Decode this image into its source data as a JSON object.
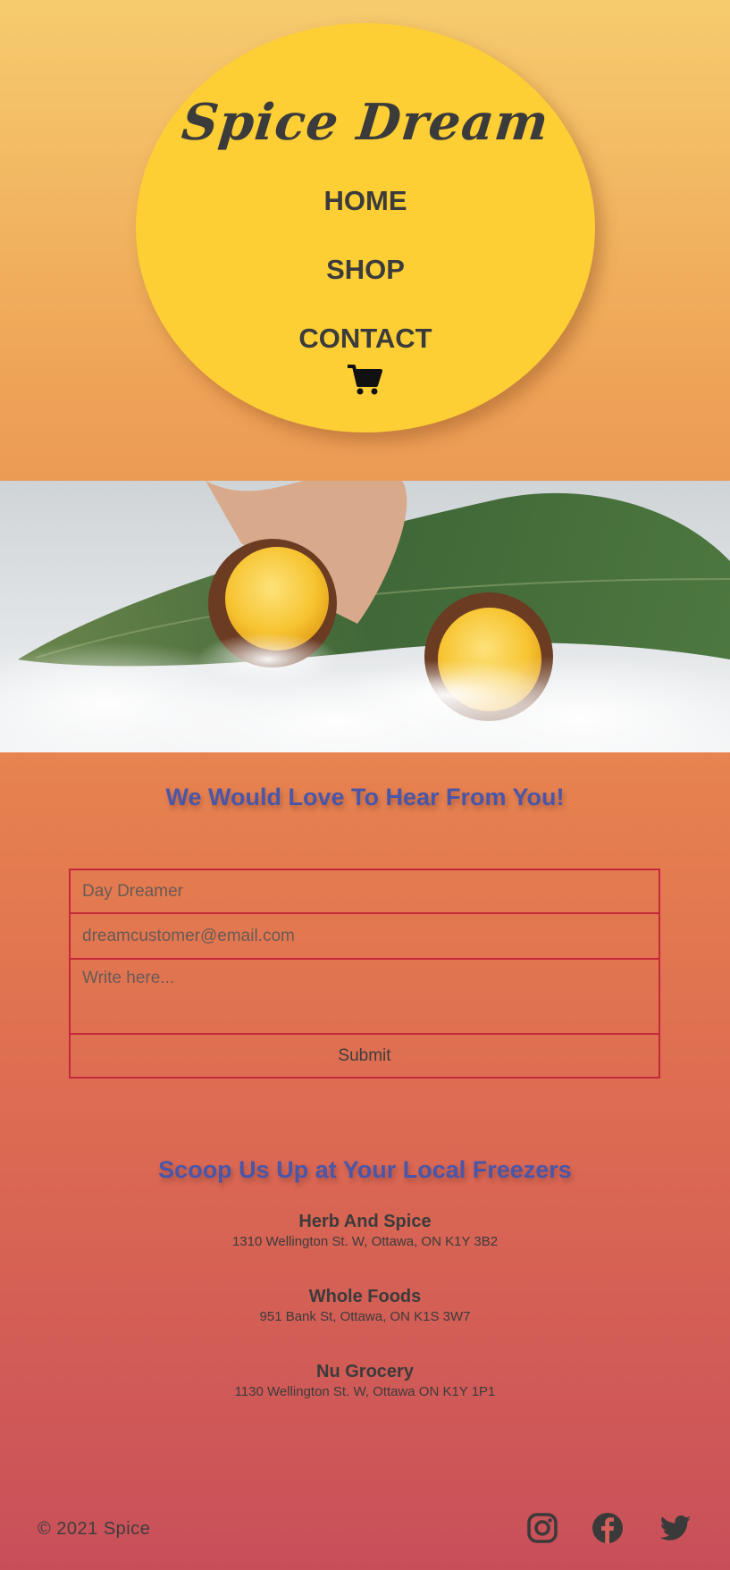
{
  "brand": {
    "logo_text": "Spice Dream"
  },
  "nav": {
    "items": [
      "HOME",
      "SHOP",
      "CONTACT"
    ],
    "cart_icon": "shopping-cart-icon"
  },
  "hero": {
    "image_alt": ""
  },
  "contact": {
    "title": "We Would Love To Hear From You!",
    "name_placeholder": "Day Dreamer",
    "email_placeholder": "dreamcustomer@email.com",
    "message_placeholder": "Write here...",
    "submit_label": "Submit"
  },
  "stores": {
    "title": "Scoop Us Up at Your Local Freezers",
    "items": [
      {
        "name": "Herb And Spice",
        "address": "1310 Wellington St. W, Ottawa, ON K1Y 3B2"
      },
      {
        "name": "Whole Foods",
        "address": "951 Bank St, Ottawa, ON K1S 3W7"
      },
      {
        "name": "Nu Grocery",
        "address": "1130 Wellington St. W, Ottawa ON K1Y 1P1"
      }
    ]
  },
  "footer": {
    "copyright": "© 2021 Spice",
    "social": [
      "instagram-icon",
      "facebook-icon",
      "twitter-icon"
    ]
  },
  "colors": {
    "oval": "#fdcf35",
    "heading": "#4a56a8",
    "form_border": "#c4283a",
    "text": "#3b3b3b"
  }
}
